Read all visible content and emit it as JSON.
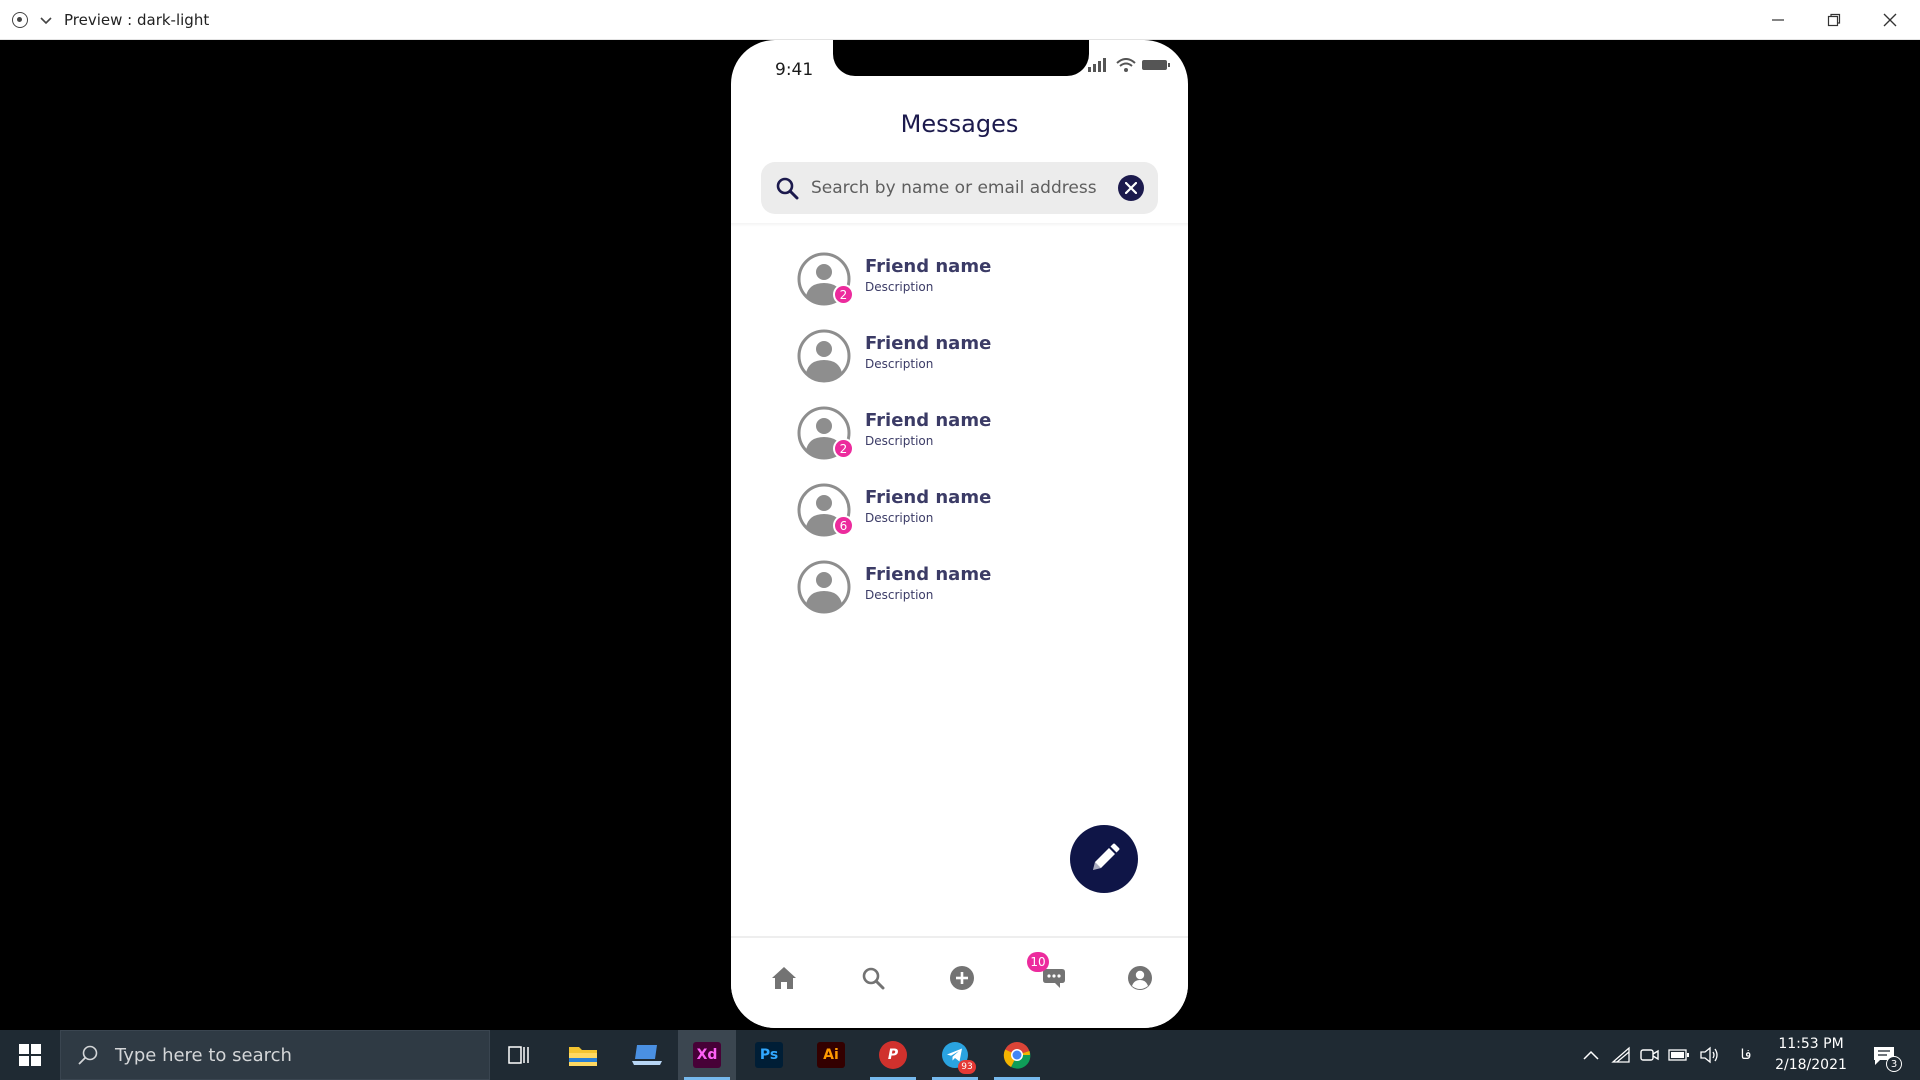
{
  "window": {
    "title": "Preview : dark-light"
  },
  "phone": {
    "status_time": "9:41",
    "header_title": "Messages",
    "search": {
      "placeholder": "Search by name or email address"
    },
    "friends": [
      {
        "name": "Friend name",
        "description": "Description",
        "badge": "2"
      },
      {
        "name": "Friend name",
        "description": "Description",
        "badge": ""
      },
      {
        "name": "Friend name",
        "description": "Description",
        "badge": "2"
      },
      {
        "name": "Friend name",
        "description": "Description",
        "badge": "6"
      },
      {
        "name": "Friend name",
        "description": "Description",
        "badge": ""
      }
    ],
    "tabs": [
      {
        "id": "home",
        "icon": "home-icon"
      },
      {
        "id": "search",
        "icon": "search-icon"
      },
      {
        "id": "add",
        "icon": "plus-circle-icon"
      },
      {
        "id": "messages",
        "icon": "chat-icon",
        "badge": "10"
      },
      {
        "id": "profile",
        "icon": "profile-icon"
      }
    ],
    "colors": {
      "primary": "#1c1a4d",
      "badge": "#ec2b9d",
      "fab": "#0f1547"
    }
  },
  "taskbar": {
    "search_placeholder": "Type here to search",
    "apps": [
      {
        "name": "Task View",
        "icon": "task-view-icon"
      },
      {
        "name": "File Explorer",
        "icon": "folder-icon"
      },
      {
        "name": "App",
        "icon": "laptop-icon"
      },
      {
        "name": "Adobe XD",
        "label": "Xd",
        "active": true
      },
      {
        "name": "Photoshop",
        "label": "Ps"
      },
      {
        "name": "Illustrator",
        "label": "Ai"
      },
      {
        "name": "Psiphon",
        "label": "P"
      },
      {
        "name": "Telegram",
        "icon": "telegram-icon",
        "badge": "93"
      },
      {
        "name": "Chrome",
        "icon": "chrome-icon"
      }
    ],
    "language": "فا",
    "time": "11:53 PM",
    "date": "2/18/2021",
    "notifications": "3"
  }
}
